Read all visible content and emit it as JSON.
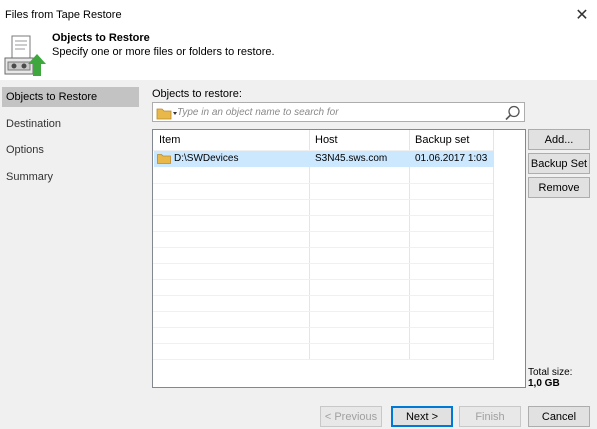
{
  "window": {
    "title": "Files from Tape Restore"
  },
  "header": {
    "title": "Objects to Restore",
    "subtitle": "Specify one or more files or folders to restore.",
    "icon": "tape-restore-icon"
  },
  "sidebar": {
    "items": [
      {
        "label": "Objects to Restore",
        "active": true
      },
      {
        "label": "Destination",
        "active": false
      },
      {
        "label": "Options",
        "active": false
      },
      {
        "label": "Summary",
        "active": false
      }
    ]
  },
  "main": {
    "objects_label": "Objects to restore:",
    "search": {
      "placeholder": "Type in an object name to search for",
      "value": ""
    },
    "table": {
      "columns": [
        "Item",
        "Host",
        "Backup set"
      ],
      "rows": [
        {
          "item": "D:\\SWDevices",
          "host": "S3N45.sws.com",
          "backup_set": "01.06.2017 1:03"
        }
      ]
    },
    "buttons": {
      "add": "Add...",
      "backup_set": "Backup Set",
      "remove": "Remove"
    },
    "total": {
      "label": "Total size:",
      "value": "1,0 GB"
    }
  },
  "footer": {
    "previous": "< Previous",
    "next": "Next >",
    "finish": "Finish",
    "cancel": "Cancel"
  },
  "colors": {
    "panel": "#f0f0f0",
    "active_nav": "#c3c3c3",
    "row_selected": "#cce8ff",
    "primary_border": "#0078d7",
    "folder": "#e8b84a"
  }
}
